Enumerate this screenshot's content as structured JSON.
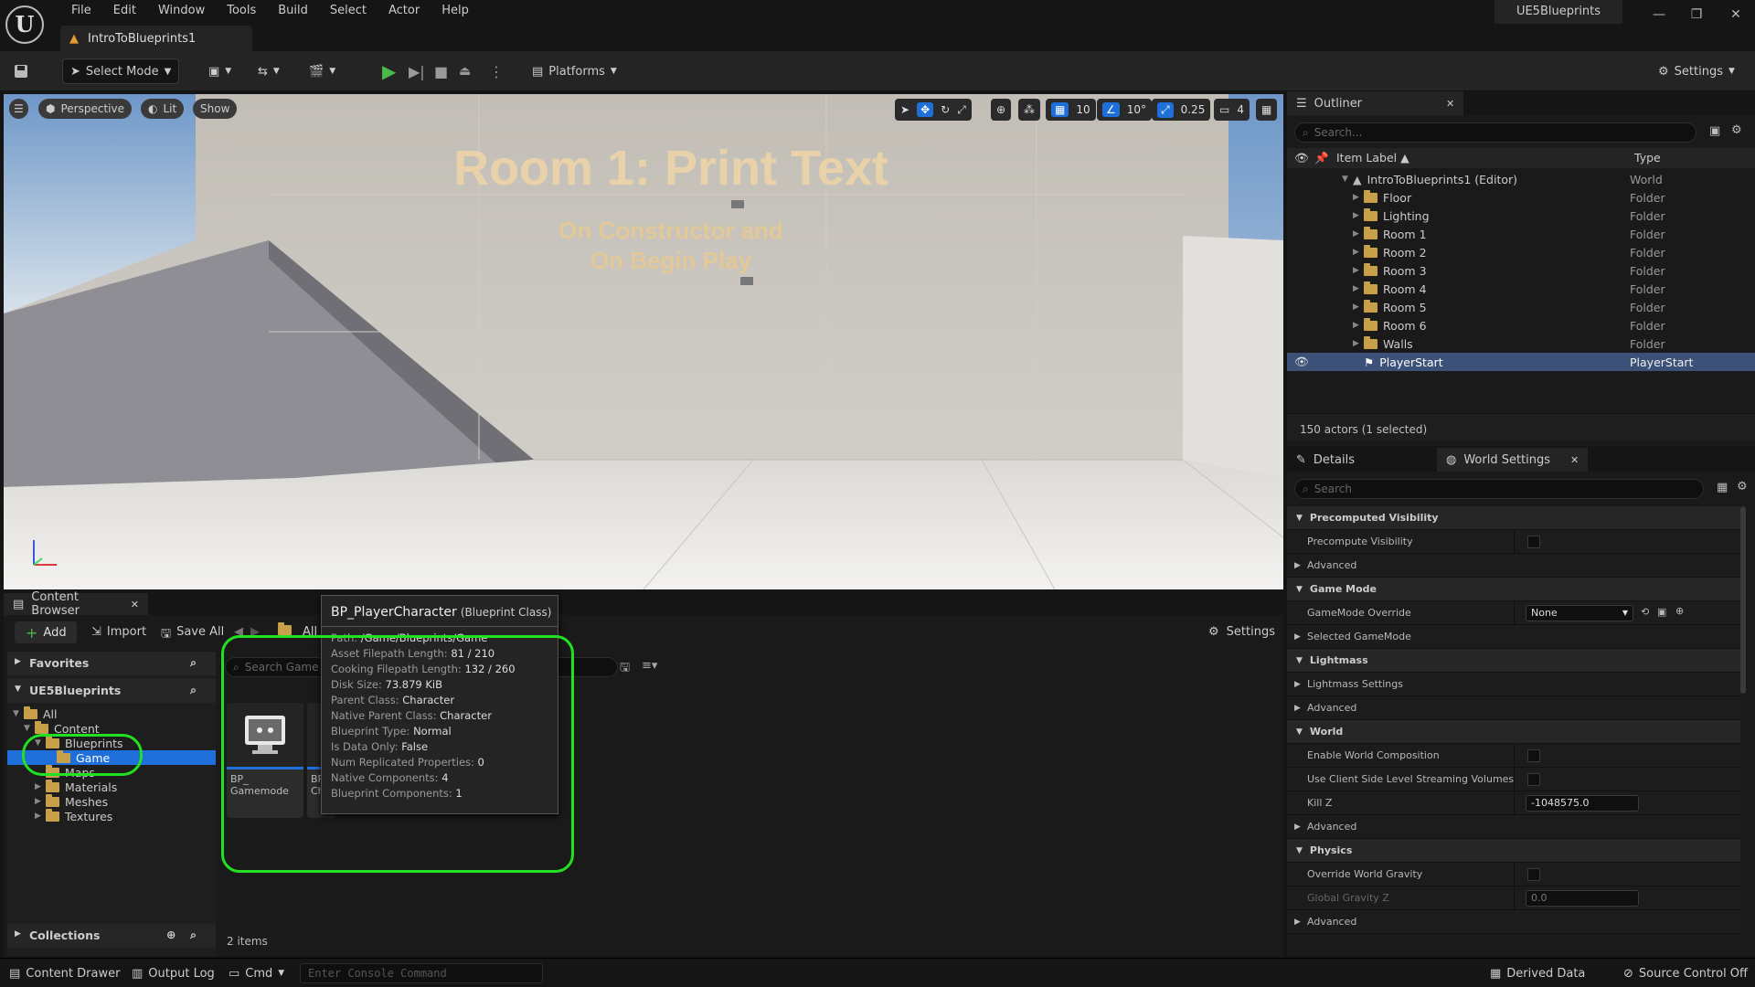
{
  "app": {
    "menu": [
      "File",
      "Edit",
      "Window",
      "Tools",
      "Build",
      "Select",
      "Actor",
      "Help"
    ],
    "doc_tab": "IntroToBlueprints1",
    "project_name": "UE5Blueprints"
  },
  "toolbar": {
    "select_mode": "Select Mode",
    "platforms": "Platforms",
    "settings": "Settings"
  },
  "viewport": {
    "perspective": "Perspective",
    "lit": "Lit",
    "show": "Show",
    "grid_snap": "10",
    "rot_snap": "10°",
    "scale_snap": "0.25",
    "cam_speed": "4",
    "room_title": "Room 1: Print Text",
    "room_sub_1": "On Constructor and",
    "room_sub_2": "On Begin Play"
  },
  "outliner": {
    "tab": "Outliner",
    "search_placeholder": "Search...",
    "col_label": "Item Label ▲",
    "col_type": "Type",
    "root": {
      "label": "IntroToBlueprints1 (Editor)",
      "type": "World"
    },
    "items": [
      {
        "label": "Floor",
        "type": "Folder"
      },
      {
        "label": "Lighting",
        "type": "Folder"
      },
      {
        "label": "Room 1",
        "type": "Folder"
      },
      {
        "label": "Room 2",
        "type": "Folder"
      },
      {
        "label": "Room 3",
        "type": "Folder"
      },
      {
        "label": "Room 4",
        "type": "Folder"
      },
      {
        "label": "Room 5",
        "type": "Folder"
      },
      {
        "label": "Room 6",
        "type": "Folder"
      },
      {
        "label": "Walls",
        "type": "Folder"
      }
    ],
    "selected": {
      "label": "PlayerStart",
      "type": "PlayerStart"
    },
    "actor_count": "150 actors (1 selected)"
  },
  "details": {
    "tab_details": "Details",
    "tab_world": "World Settings",
    "search_placeholder": "Search",
    "sections": {
      "precomputed": "Precomputed Visibility",
      "precompute_visibility": "Precompute Visibility",
      "advanced": "Advanced",
      "game_mode": "Game Mode",
      "gamemode_override": "GameMode Override",
      "gamemode_value": "None",
      "selected_gamemode": "Selected GameMode",
      "lightmass": "Lightmass",
      "lightmass_settings": "Lightmass Settings",
      "world": "World",
      "enable_world_composition": "Enable World Composition",
      "client_side_streaming": "Use Client Side Level Streaming Volumes",
      "kill_z": "Kill Z",
      "kill_z_value": "-1048575.0",
      "physics": "Physics",
      "override_gravity": "Override World Gravity",
      "global_gravity": "Global Gravity Z",
      "global_gravity_value": "0.0"
    }
  },
  "content_browser": {
    "tab": "Content Browser",
    "add": "Add",
    "import": "Import",
    "save_all": "Save All",
    "path_all": "All",
    "settings": "Settings",
    "search_placeholder": "Search Game",
    "favorites": "Favorites",
    "project": "UE5Blueprints",
    "collections": "Collections",
    "tree": [
      "All",
      "Content",
      "Blueprints",
      "Game",
      "Maps",
      "Materials",
      "Meshes",
      "Textures"
    ],
    "tile1_line1": "BP_",
    "tile1_line2": "Gamemode",
    "tile2_line1": "BP",
    "tile2_line2": "Ch",
    "items_count": "2 items"
  },
  "tooltip": {
    "title": "BP_PlayerCharacter",
    "subtitle": "(Blueprint Class)",
    "rows": [
      {
        "k": "Path:",
        "v": "/Game/Blueprints/Game"
      },
      {
        "k": "Asset Filepath Length:",
        "v": "81 / 210"
      },
      {
        "k": "Cooking Filepath Length:",
        "v": "132 / 260"
      },
      {
        "k": "Disk Size:",
        "v": "73.879 KiB"
      },
      {
        "k": "Parent Class:",
        "v": "Character"
      },
      {
        "k": "Native Parent Class:",
        "v": "Character"
      },
      {
        "k": "Blueprint Type:",
        "v": "Normal"
      },
      {
        "k": "Is Data Only:",
        "v": "False"
      },
      {
        "k": "Num Replicated Properties:",
        "v": "0"
      },
      {
        "k": "Native Components:",
        "v": "4"
      },
      {
        "k": "Blueprint Components:",
        "v": "1"
      }
    ]
  },
  "statusbar": {
    "content_drawer": "Content Drawer",
    "output_log": "Output Log",
    "cmd": "Cmd",
    "console_placeholder": "Enter Console Command",
    "derived_data": "Derived Data",
    "source_control": "Source Control Off"
  },
  "colors": {
    "accent": "#1e6fd9",
    "highlight": "#22e022",
    "play": "#4ab84a"
  }
}
